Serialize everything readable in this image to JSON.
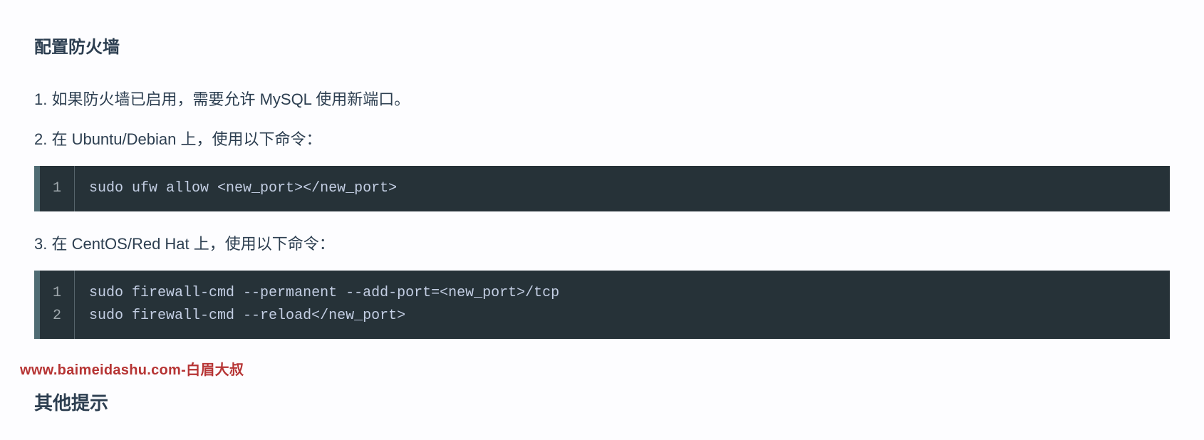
{
  "section_title": "配置防火墙",
  "items": [
    {
      "text": "1. 如果防火墙已启用，需要允许 MySQL 使用新端口。"
    },
    {
      "text": "2. 在 Ubuntu/Debian 上，使用以下命令："
    }
  ],
  "code1": {
    "gutter": [
      "1"
    ],
    "lines": [
      "sudo ufw allow <new_port></new_port>"
    ]
  },
  "item3": {
    "text": "3. 在 CentOS/Red Hat 上，使用以下命令："
  },
  "code2": {
    "gutter": [
      "1",
      "2"
    ],
    "lines": [
      "sudo firewall-cmd --permanent --add-port=<new_port>/tcp",
      "sudo firewall-cmd --reload</new_port>"
    ]
  },
  "watermark": "www.baimeidashu.com-白眉大叔",
  "sub_heading": "其他提示"
}
